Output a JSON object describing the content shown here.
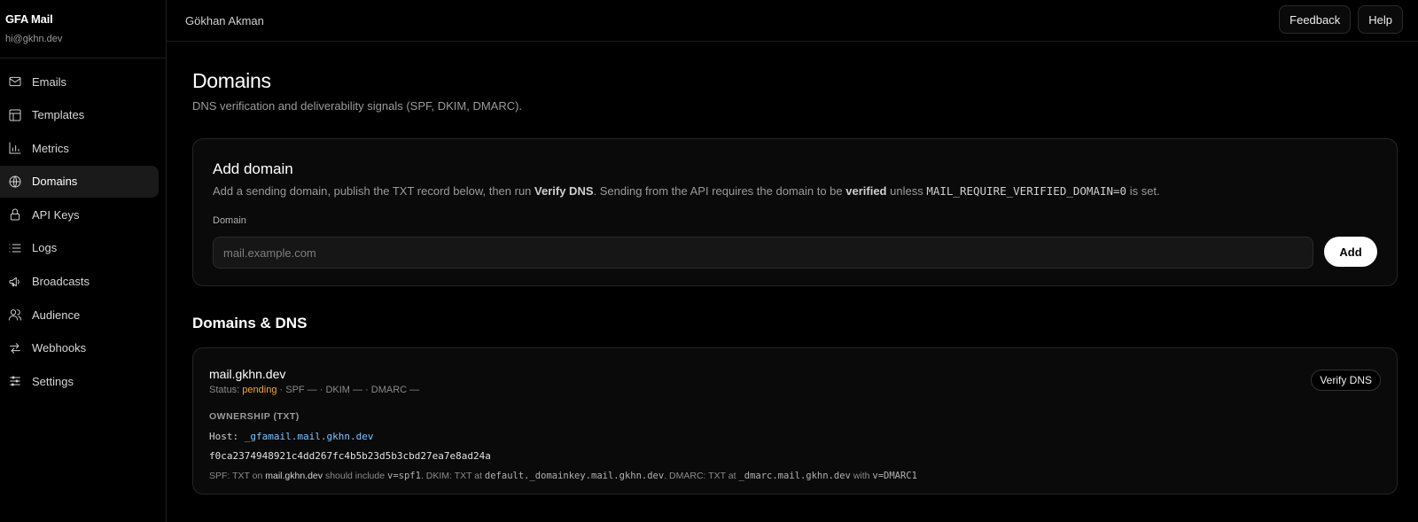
{
  "brand": {
    "name": "GFA Mail",
    "email": "hi@gkhn.dev"
  },
  "sidebar": {
    "items": [
      {
        "label": "Emails",
        "icon": "mail-icon"
      },
      {
        "label": "Templates",
        "icon": "layout-icon"
      },
      {
        "label": "Metrics",
        "icon": "bar-chart-icon"
      },
      {
        "label": "Domains",
        "icon": "globe-icon",
        "active": true
      },
      {
        "label": "API Keys",
        "icon": "lock-icon"
      },
      {
        "label": "Logs",
        "icon": "list-icon"
      },
      {
        "label": "Broadcasts",
        "icon": "megaphone-icon"
      },
      {
        "label": "Audience",
        "icon": "users-icon"
      },
      {
        "label": "Webhooks",
        "icon": "arrows-icon"
      },
      {
        "label": "Settings",
        "icon": "sliders-icon"
      }
    ]
  },
  "header": {
    "user": "Gökhan Akman",
    "feedback_label": "Feedback",
    "help_label": "Help"
  },
  "page": {
    "title": "Domains",
    "subtitle": "DNS verification and deliverability signals (SPF, DKIM, DMARC)."
  },
  "add_domain": {
    "title": "Add domain",
    "desc_1": "Add a sending domain, publish the TXT record below, then run ",
    "desc_verify": "Verify DNS",
    "desc_2": ". Sending from the API requires the domain to be ",
    "desc_verified": "verified",
    "desc_3": " unless ",
    "desc_env": "MAIL_REQUIRE_VERIFIED_DOMAIN=0",
    "desc_4": " is set.",
    "field_label": "Domain",
    "placeholder": "mail.example.com",
    "add_label": "Add"
  },
  "dns": {
    "section_title": "Domains & DNS",
    "domain": "mail.gkhn.dev",
    "status_prefix": "Status: ",
    "status_value": "pending",
    "status_rest": " · SPF — · DKIM — · DMARC —",
    "verify_label": "Verify DNS",
    "ownership_label": "OWNERSHIP (TXT)",
    "host_prefix": "Host: ",
    "host_value": "_gfamail.mail.gkhn.dev",
    "txt_value": "f0ca2374948921c4dd267fc4b5b23d5b3cbd27ea7e8ad24a",
    "help": {
      "spf_prefix": "SPF: TXT on ",
      "spf_domain": "mail.gkhn.dev",
      "spf_mid": " should include ",
      "spf_value": "v=spf1",
      "dkim_prefix": ". DKIM: TXT at ",
      "dkim_host": "default._domainkey.mail.gkhn.dev",
      "dmarc_prefix": ". DMARC: TXT at ",
      "dmarc_host": "_dmarc.mail.gkhn.dev",
      "dmarc_mid": " with ",
      "dmarc_value": "v=DMARC1"
    }
  },
  "colors": {
    "accent_pending": "#f5a524",
    "host_blue": "#7cc3ff"
  }
}
